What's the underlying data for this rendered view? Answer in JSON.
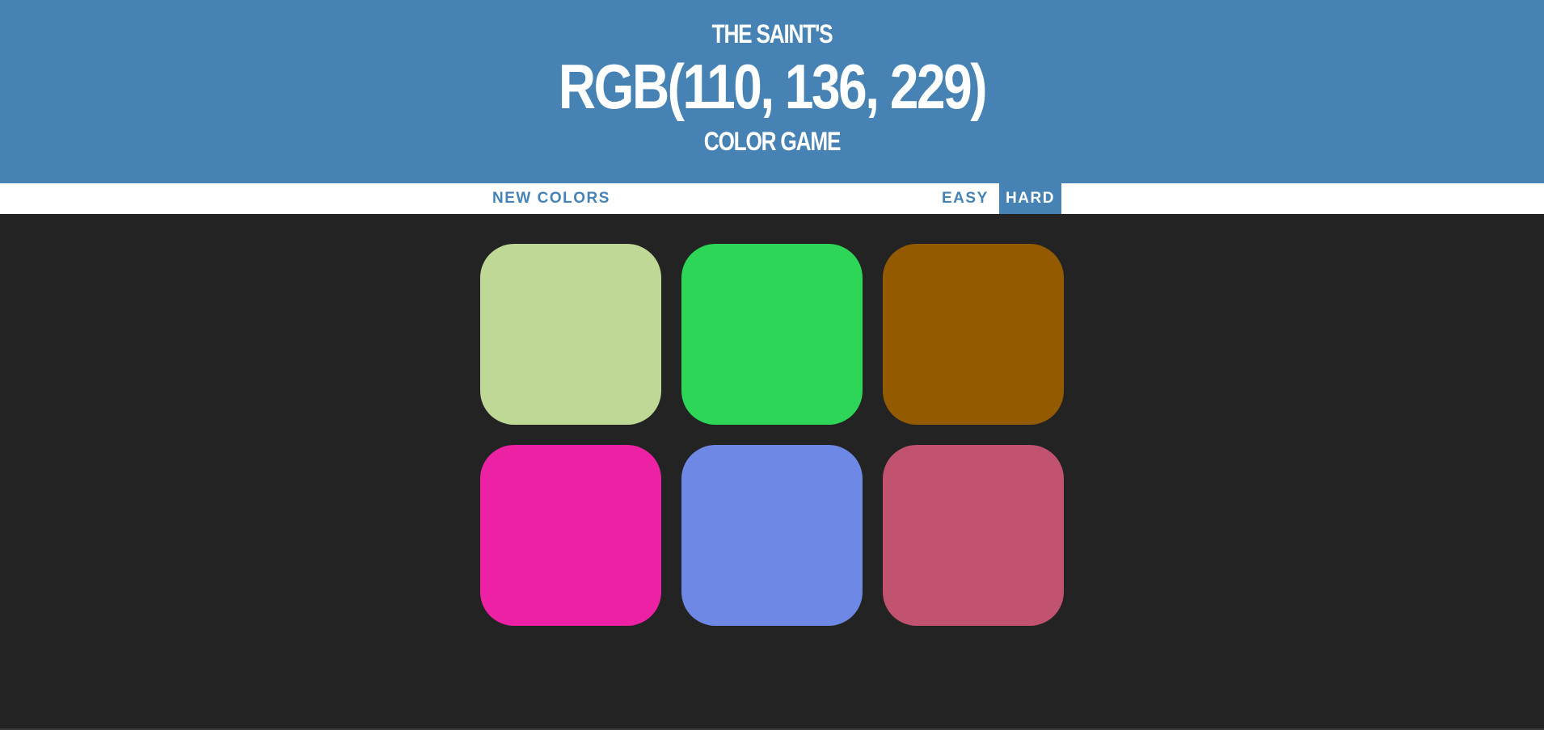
{
  "header": {
    "line1": "THE SAINT'S",
    "rgb_display": "RGB(110, 136, 229)",
    "line3": "COLOR GAME"
  },
  "controls": {
    "new_colors_label": "NEW COLORS",
    "easy_label": "EASY",
    "hard_label": "HARD",
    "selected_mode": "hard"
  },
  "squares": [
    {
      "color": "#bfd895"
    },
    {
      "color": "#2dd656"
    },
    {
      "color": "#945a00"
    },
    {
      "color": "#ec21a3"
    },
    {
      "color": "#6e88e5"
    },
    {
      "color": "#c15270"
    }
  ],
  "colors": {
    "header_bg": "#4682b4",
    "body_bg": "#232323",
    "stripe_bg": "#ffffff"
  }
}
